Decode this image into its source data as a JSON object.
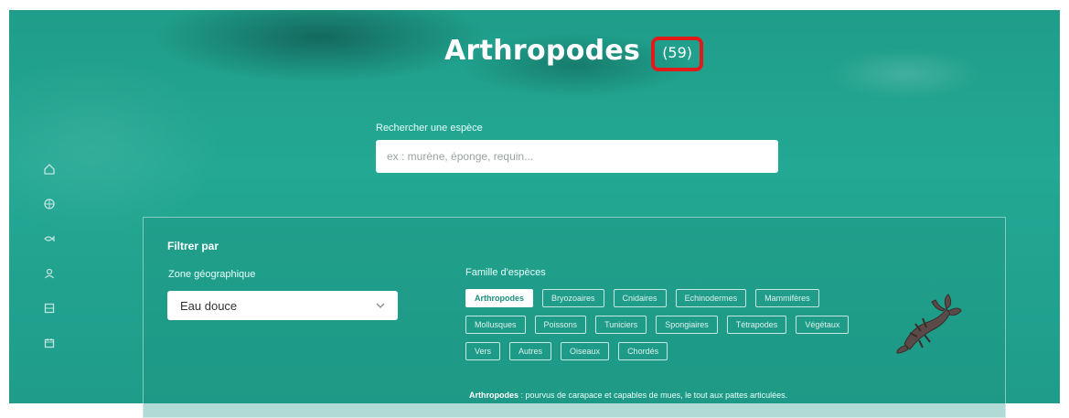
{
  "header": {
    "title": "Arthropodes",
    "count": "(59)"
  },
  "search": {
    "label": "Rechercher une espèce",
    "placeholder": "ex : murène, éponge, requin..."
  },
  "filter": {
    "title": "Filtrer par",
    "zone_label": "Zone géographique",
    "zone_value": "Eau douce",
    "family_label": "Famille d'espèces",
    "families": [
      "Arthropodes",
      "Bryozoaires",
      "Cnidaires",
      "Echinodermes",
      "Mammifères",
      "Mollusques",
      "Poissons",
      "Tuniciers",
      "Spongiaires",
      "Tétrapodes",
      "Végétaux",
      "Vers",
      "Autres",
      "Oiseaux",
      "Chordés"
    ],
    "active_family": "Arthropodes",
    "description_name": "Arthropodes",
    "description_text": " : pourvus de carapace et capables de mues, le tout aux pattes articulées."
  },
  "sidebar": {
    "icons": [
      "home-icon",
      "globe-icon",
      "fish-icon",
      "user-icon",
      "grid-icon",
      "calendar-icon"
    ]
  },
  "colors": {
    "background": "#22a590",
    "highlight": "#e11a1a",
    "chip_active_text": "#1d8f7f"
  }
}
